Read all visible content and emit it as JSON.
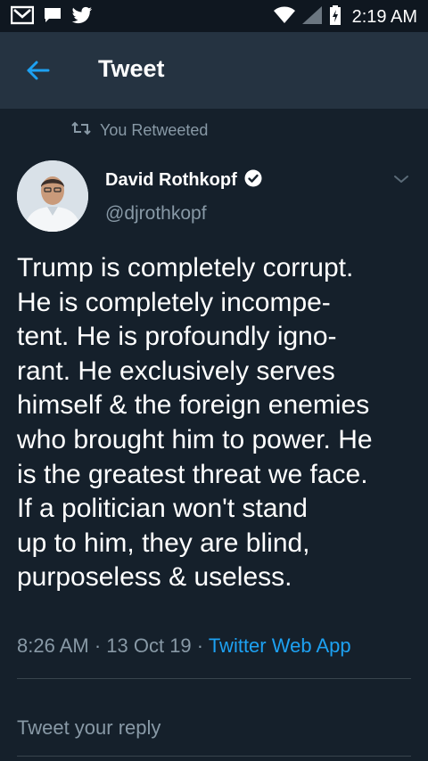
{
  "status_bar": {
    "time": "2:19 AM",
    "left_icons": [
      "gmail-icon",
      "message-icon",
      "twitter-icon"
    ],
    "right_icons": [
      "wifi-icon",
      "signal-icon",
      "battery-charging-icon"
    ]
  },
  "header": {
    "title": "Tweet",
    "back_icon": "back-arrow-icon"
  },
  "retweet": {
    "label": "You Retweeted",
    "icon": "retweet-icon"
  },
  "author": {
    "display_name": "David Rothkopf",
    "handle": "@djrothkopf",
    "verified_icon": "verified-badge-icon"
  },
  "tweet": {
    "lines": [
      "Trump is completely corrupt.",
      "He is completely incompe-",
      "tent.  He is profoundly igno-",
      "rant. He exclusively serves",
      "himself & the foreign enemies",
      "who brought him to power. He",
      "is the greatest threat we face.",
      "If a politician won't stand",
      "up to him, they are blind,",
      "purposeless & useless."
    ]
  },
  "meta": {
    "time": "8:26 AM",
    "separator": " · ",
    "date": "13 Oct 19",
    "source": "Twitter Web App"
  },
  "reply": {
    "placeholder": "Tweet your reply"
  },
  "colors": {
    "background": "#15202b",
    "header": "#253341",
    "accent": "#1da1f2",
    "secondary_text": "#8899a6"
  }
}
